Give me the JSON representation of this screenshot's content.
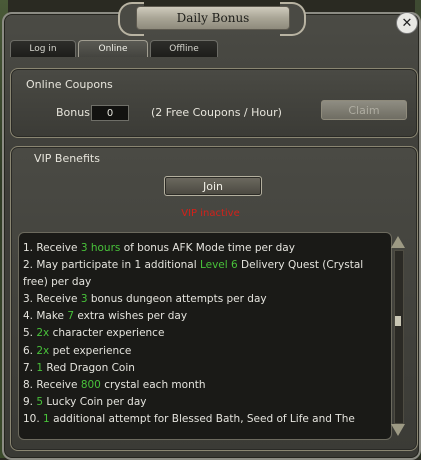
{
  "window": {
    "title": "Daily Bonus"
  },
  "tabs": [
    {
      "label": "Log in",
      "active": false
    },
    {
      "label": "Online",
      "active": true
    },
    {
      "label": "Offline",
      "active": false
    }
  ],
  "online_coupons": {
    "heading": "Online Coupons",
    "bonus_label": "Bonus",
    "bonus_value": "0",
    "rate_text": "(2 Free Coupons / Hour)",
    "claim_label": "Claim"
  },
  "vip": {
    "heading": "VIP Benefits",
    "join_label": "Join",
    "status_text": "VIP inactive",
    "benefits": [
      [
        "1. Receive ",
        "3 hours",
        " of bonus AFK Mode time per day"
      ],
      [
        "2. May participate in 1 additional ",
        "Level 6",
        " Delivery Quest (Crystal"
      ],
      [
        "free) per day",
        "",
        ""
      ],
      [
        "3. Receive ",
        "3",
        " bonus dungeon attempts per day"
      ],
      [
        "4. Make ",
        "7",
        " extra wishes per day"
      ],
      [
        "5. ",
        "2x",
        " character experience"
      ],
      [
        "6. ",
        "2x",
        " pet experience"
      ],
      [
        "7. ",
        "1",
        " Red Dragon Coin"
      ],
      [
        "8. Receive ",
        "800",
        " crystal each month"
      ],
      [
        "9. ",
        "5",
        " Lucky Coin per day"
      ],
      [
        "10. ",
        "1",
        " additional attempt for Blessed Bath, Seed of Life and The"
      ]
    ]
  },
  "colors": {
    "highlight": "#48c23a",
    "status_inactive": "#d3211a",
    "accent_border": "#8a8672"
  },
  "icons": {
    "close": "close-icon"
  }
}
